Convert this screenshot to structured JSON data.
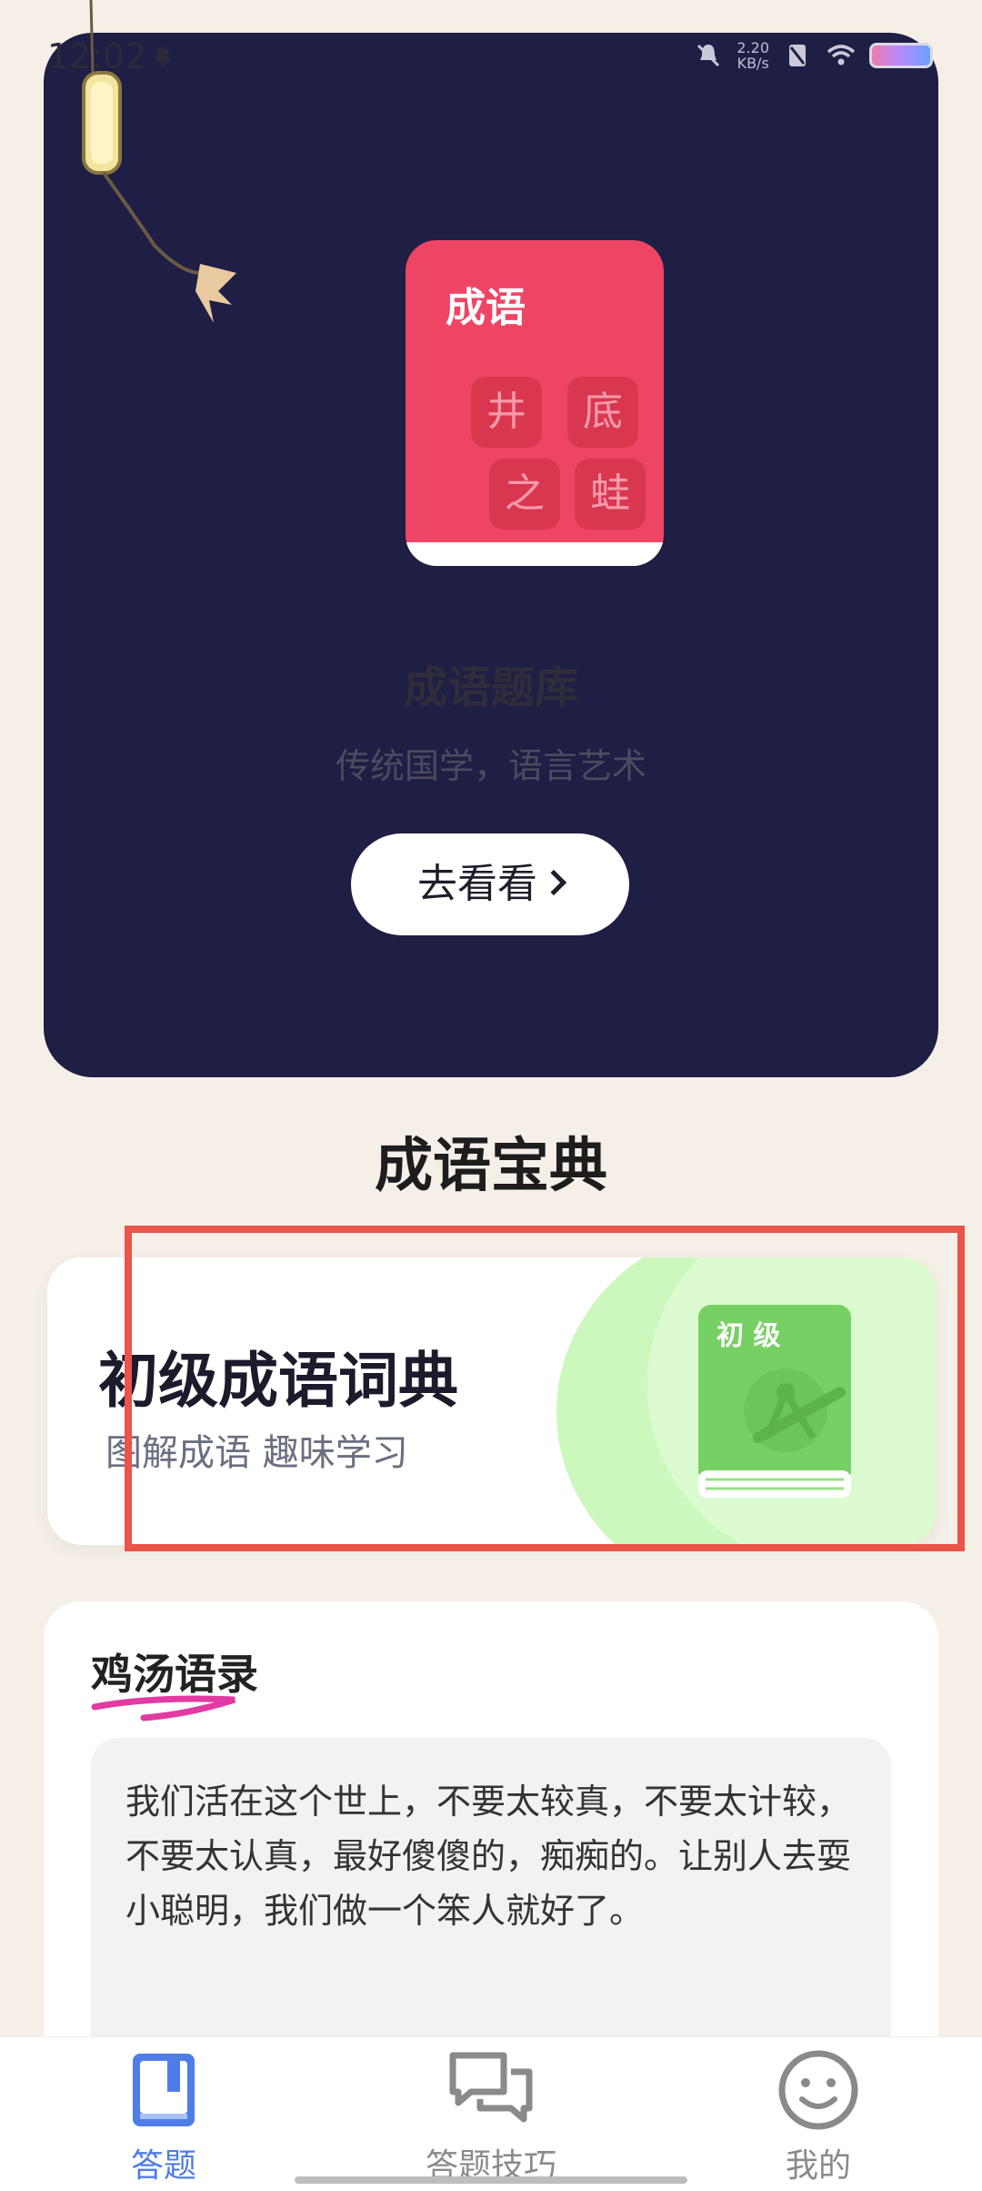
{
  "status_bar": {
    "time": "12:02",
    "net_speed_value": "2.20",
    "net_speed_unit": "KB/s"
  },
  "hero": {
    "book_title": "成语",
    "tiles": [
      "井",
      "底",
      "之",
      "蛙"
    ],
    "title": "成语题库",
    "subtitle": "传统国学，语言艺术",
    "button_label": "去看看"
  },
  "section_title": "成语宝典",
  "dictionary_card": {
    "title": "初级成语词典",
    "subtitle": "图解成语 趣味学习",
    "book_badge": "初 级"
  },
  "quote": {
    "title": "鸡汤语录",
    "text": "我们活在这个世上，不要太较真，不要太计较，不要太认真，最好傻傻的，痴痴的。让别人去耍小聪明，我们做一个笨人就好了。"
  },
  "bottom_nav": {
    "items": [
      {
        "label": "答题",
        "active": true
      },
      {
        "label": "答题技巧",
        "active": false
      },
      {
        "label": "我的",
        "active": false
      }
    ]
  },
  "colors": {
    "accent": "#4f7de8",
    "hero_bg": "#1f1e44",
    "book_red": "#ef4565",
    "highlight": "#e9544b"
  }
}
